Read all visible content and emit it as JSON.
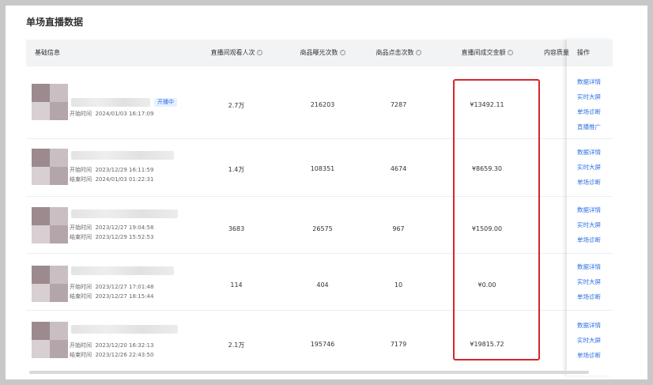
{
  "page_title": "单场直播数据",
  "columns": {
    "basic_info": "基础信息",
    "viewers": "直播间观看人次",
    "exposures": "商品曝光次数",
    "clicks": "商品点击次数",
    "gmv": "直播间成交金额",
    "content_quality": "内容质量",
    "actions": "操作"
  },
  "info_glyph": "?",
  "live_badge": "开播中",
  "rows": [
    {
      "start_label": "开始时间",
      "start_time": "2024/01/03 16:17:09",
      "end_label": "",
      "end_time": "",
      "viewers": "2.7万",
      "exposures": "216203",
      "clicks": "7287",
      "gmv": "¥13492.11",
      "actions": [
        "数据详情",
        "实时大屏",
        "单场诊断",
        "直播推广"
      ]
    },
    {
      "start_label": "开始时间",
      "start_time": "2023/12/29 16:11:59",
      "end_label": "结束时间",
      "end_time": "2024/01/03 01:22:31",
      "viewers": "1.4万",
      "exposures": "108351",
      "clicks": "4674",
      "gmv": "¥8659.30",
      "actions": [
        "数据详情",
        "实时大屏",
        "单场诊断"
      ]
    },
    {
      "start_label": "开始时间",
      "start_time": "2023/12/27 19:04:58",
      "end_label": "结束时间",
      "end_time": "2023/12/29 15:52:53",
      "viewers": "3683",
      "exposures": "26575",
      "clicks": "967",
      "gmv": "¥1509.00",
      "actions": [
        "数据详情",
        "实时大屏",
        "单场诊断"
      ]
    },
    {
      "start_label": "开始时间",
      "start_time": "2023/12/27 17:01:48",
      "end_label": "结束时间",
      "end_time": "2023/12/27 18:15:44",
      "viewers": "114",
      "exposures": "404",
      "clicks": "10",
      "gmv": "¥0.00",
      "actions": [
        "数据详情",
        "实时大屏",
        "单场诊断"
      ]
    },
    {
      "start_label": "开始时间",
      "start_time": "2023/12/20 16:32:13",
      "end_label": "结束时间",
      "end_time": "2023/12/26 22:43:50",
      "viewers": "2.1万",
      "exposures": "195746",
      "clicks": "7179",
      "gmv": "¥19815.72",
      "actions": [
        "数据详情",
        "实时大屏",
        "单场诊断"
      ]
    }
  ],
  "colors": {
    "link": "#2c70e6",
    "highlight_box": "#d6262b",
    "header_bg": "#f2f3f5"
  }
}
